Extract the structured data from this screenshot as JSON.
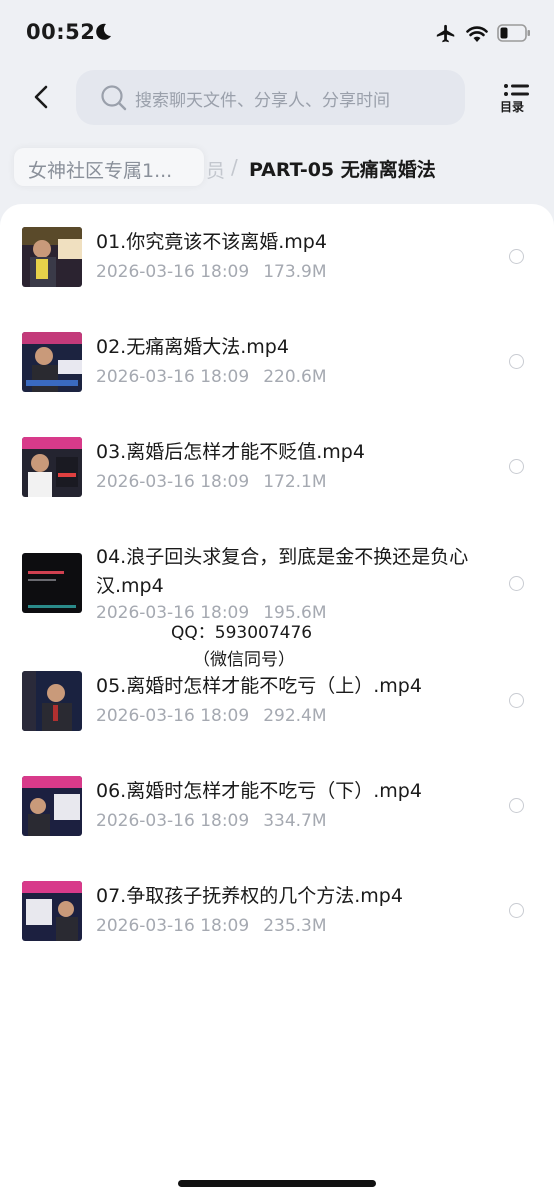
{
  "status": {
    "time": "00:52"
  },
  "search": {
    "placeholder": "搜索聊天文件、分享人、分享时间"
  },
  "toc_label": "目录",
  "breadcrumb": {
    "first": "女神社区专属1...",
    "hidden": "员",
    "separator": "/",
    "current": "PART-05 无痛离婚法"
  },
  "files": [
    {
      "name": "01.你究竟该不该离婚.mp4",
      "date": "2026-03-16 18:09",
      "size": "173.9M"
    },
    {
      "name": "02.无痛离婚大法.mp4",
      "date": "2026-03-16 18:09",
      "size": "220.6M"
    },
    {
      "name": "03.离婚后怎样才能不贬值.mp4",
      "date": "2026-03-16 18:09",
      "size": "172.1M"
    },
    {
      "name": "04.浪子回头求复合，到底是金不换还是负心汉.mp4",
      "date": "2026-03-16 18:09",
      "size": "195.6M"
    },
    {
      "name": "05.离婚时怎样才能不吃亏（上）.mp4",
      "date": "2026-03-16 18:09",
      "size": "292.4M"
    },
    {
      "name": "06.离婚时怎样才能不吃亏（下）.mp4",
      "date": "2026-03-16 18:09",
      "size": "334.7M"
    },
    {
      "name": "07.争取孩子抚养权的几个方法.mp4",
      "date": "2026-03-16 18:09",
      "size": "235.3M"
    }
  ],
  "watermark": {
    "line1": "QQ：593007476",
    "line2": "（微信同号）"
  }
}
